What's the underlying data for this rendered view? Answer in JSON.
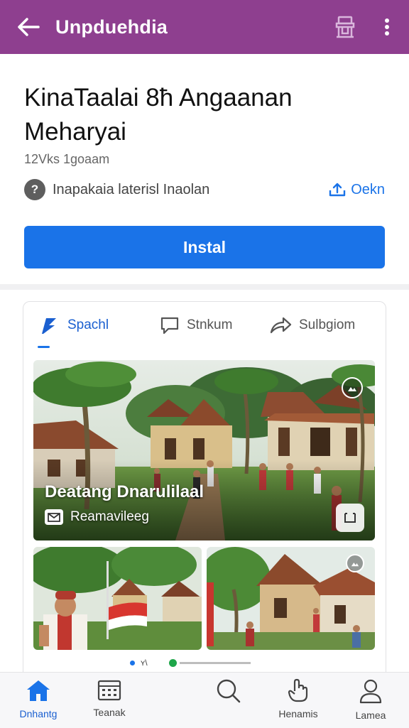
{
  "header": {
    "title": "Unpduehdia"
  },
  "app": {
    "title_line1": "KinaTaalai 8ħ Angaanan",
    "title_line2": "Meharyai",
    "meta": "12Vks 1goaam",
    "category_icon_glyph": "?",
    "category": "Inapakaia laterisl Inaolan",
    "share_label": "Oekn",
    "install_label": "Instal",
    "accent": "#1a73e8",
    "header_color": "#8e3f8f"
  },
  "tabs": [
    {
      "label": "Spachl",
      "icon": "bolt-icon",
      "active": true
    },
    {
      "label": "Stnkum",
      "icon": "chat-icon",
      "active": false
    },
    {
      "label": "Sulbgiom",
      "icon": "share-arrow-icon",
      "active": false
    }
  ],
  "gallery": {
    "hero_title": "Deatang Dnarulilaal",
    "hero_subtitle": "Reamavileeg",
    "pager_label": "ʏ\\"
  },
  "bottom_nav": [
    {
      "label": "Dnhantg",
      "icon": "home-icon",
      "active": true
    },
    {
      "label": "Teanak",
      "icon": "calendar-grid-icon",
      "active": false
    },
    {
      "label": "",
      "icon": "search-icon",
      "active": false
    },
    {
      "label": "Henamis",
      "icon": "hand-icon",
      "active": false
    },
    {
      "label": "Lamea",
      "icon": "person-icon",
      "active": false
    }
  ]
}
